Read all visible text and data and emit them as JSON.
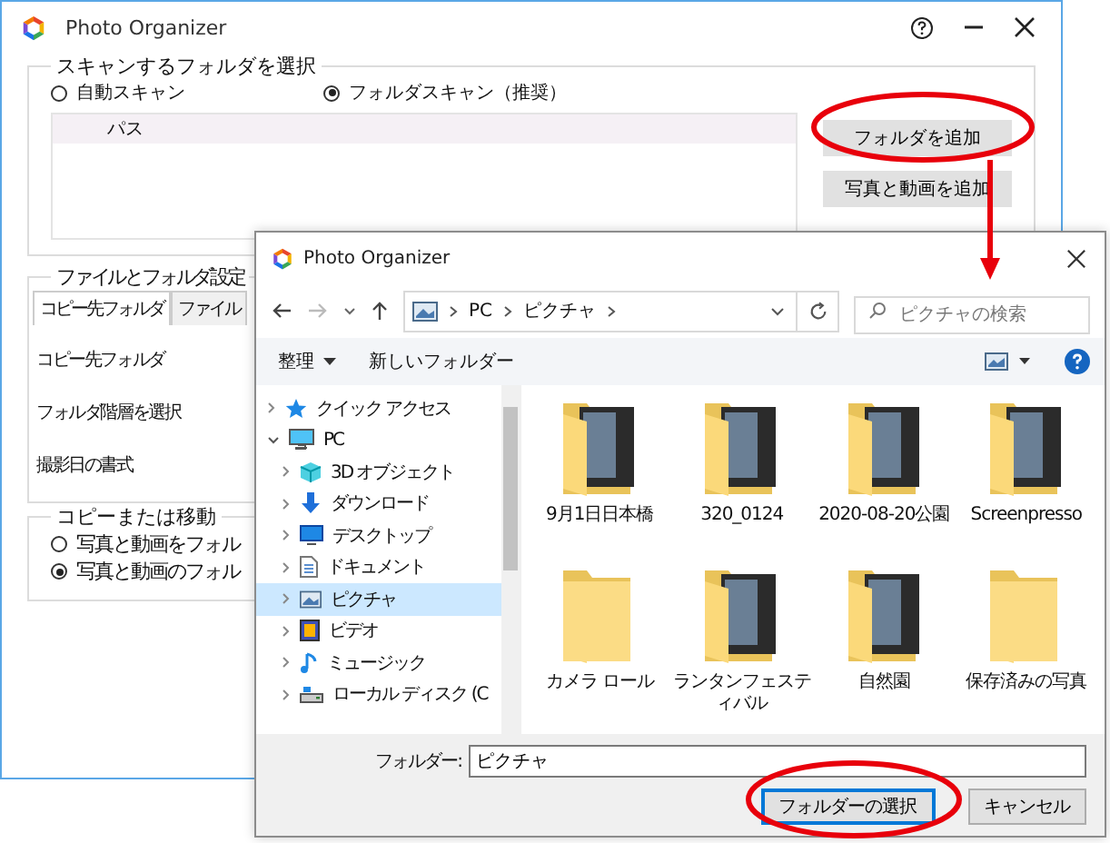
{
  "window": {
    "title": "Photo Organizer",
    "scan_group": {
      "title": "スキャンするフォルダを選択",
      "options": [
        {
          "label": "自動スキャン",
          "selected": false
        },
        {
          "label": "フォルダスキャン（推奨）",
          "selected": true
        }
      ],
      "column": "パス",
      "buttons": [
        "フォルダを追加",
        "写真と動画を追加"
      ]
    },
    "settings_group": {
      "title": "ファイルとフォルダ設定",
      "tabs": [
        {
          "label": "コピー先フォルダ",
          "selected": true
        },
        {
          "label": "ファイル",
          "selected": false
        }
      ],
      "fields": [
        "コピー先フォルダ",
        "フォルダ階層を選択",
        "撮影日の書式"
      ]
    },
    "copy_group": {
      "title": "コピーまたは移動",
      "options": [
        {
          "label": "写真と動画をフォル",
          "selected": false
        },
        {
          "label": "写真と動画のフォル",
          "selected": true
        }
      ]
    }
  },
  "dialog": {
    "title": "Photo Organizer",
    "path": [
      "PC",
      "ピクチャ"
    ],
    "search": {
      "placeholder": "ピクチャの検索"
    },
    "toolbar": {
      "organize": "整理",
      "new_folder": "新しいフォルダー"
    },
    "nav": [
      {
        "label": "クイック アクセス",
        "kind": "star",
        "expanded": false,
        "selected": false
      },
      {
        "label": "PC",
        "kind": "computer",
        "expanded": true,
        "selected": false,
        "children": [
          {
            "label": "3D オブジェクト",
            "kind": "cube",
            "expanded": false,
            "selected": false
          },
          {
            "label": "ダウンロード",
            "kind": "download",
            "expanded": false,
            "selected": false
          },
          {
            "label": "デスクトップ",
            "kind": "desktop",
            "expanded": false,
            "selected": false
          },
          {
            "label": "ドキュメント",
            "kind": "document",
            "expanded": false,
            "selected": false
          },
          {
            "label": "ピクチャ",
            "kind": "pictures",
            "expanded": false,
            "selected": true
          },
          {
            "label": "ビデオ",
            "kind": "video",
            "expanded": false,
            "selected": false
          },
          {
            "label": "ミュージック",
            "kind": "music",
            "expanded": false,
            "selected": false
          },
          {
            "label": "ローカル ディスク (C",
            "kind": "drive",
            "expanded": false,
            "selected": false
          }
        ]
      }
    ],
    "folders": [
      {
        "name": "9月1日日本橋",
        "kind": "photos"
      },
      {
        "name": "320_0124",
        "kind": "photos"
      },
      {
        "name": "2020-08-20公園",
        "kind": "photos"
      },
      {
        "name": "Screenpresso",
        "kind": "photos"
      },
      {
        "name": "カメラ ロール",
        "kind": "empty"
      },
      {
        "name": "ランタンフェスティバル",
        "kind": "photos"
      },
      {
        "name": "自然園",
        "kind": "photos"
      },
      {
        "name": "保存済みの写真",
        "kind": "empty"
      }
    ],
    "folder_label": "フォルダー:",
    "folder_value": "ピクチャ",
    "buttons": [
      "フォルダーの選択",
      "キャンセル"
    ]
  }
}
